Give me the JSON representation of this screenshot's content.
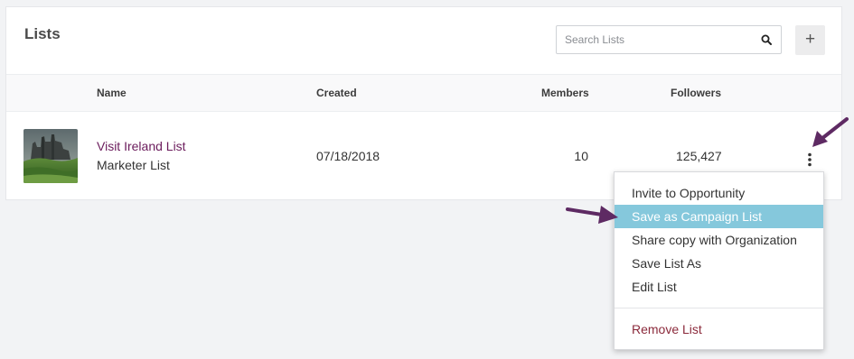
{
  "page": {
    "title": "Lists"
  },
  "search": {
    "placeholder": "Search Lists",
    "icon": "search-icon"
  },
  "toolbar": {
    "add_label": "+"
  },
  "table": {
    "columns": [
      "Name",
      "Created",
      "Members",
      "Followers"
    ],
    "rows": [
      {
        "name": "Visit Ireland List",
        "subtitle": "Marketer List",
        "created": "07/18/2018",
        "members": "10",
        "followers": "125,427"
      }
    ]
  },
  "row_menu": {
    "items": [
      "Invite to Opportunity",
      "Save as Campaign List",
      "Share copy with Organization",
      "Save List As",
      "Edit List"
    ],
    "highlighted_index": 1,
    "danger_item": "Remove List"
  },
  "colors": {
    "link": "#6b1c5c",
    "highlight": "#85c8dc",
    "danger": "#8b2a3b",
    "annotation_arrow": "#5e2a63"
  }
}
